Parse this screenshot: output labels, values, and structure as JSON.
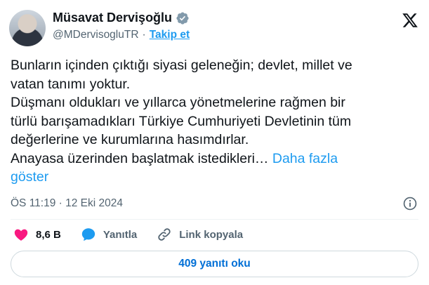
{
  "author": {
    "name": "Müsavat Dervişoğlu",
    "handle": "@MDervisogluTR",
    "separator": "·",
    "follow_label": "Takip et"
  },
  "tweet": {
    "text": "Bunların içinden çıktığı siyasi geleneğin; devlet, millet ve\nvatan tanımı yoktur.\nDüşmanı oldukları ve yıllarca yönetmelerine rağmen bir\ntürlü barışamadıkları Türkiye Cumhuriyeti Devletinin tüm\ndeğerlerine ve kurumlarına hasımdırlar.\nAnayasa üzerinden başlatmak istedikleri… ",
    "show_more_label": "Daha fazla\ngöster",
    "timestamp": "ÖS 11:19 · 12 Eki 2024"
  },
  "actions": {
    "likes_count": "8,6 B",
    "reply_label": "Yanıtla",
    "copy_link_label": "Link kopyala"
  },
  "replies_button_label": "409 yanıtı oku",
  "colors": {
    "accent": "#1d9bf0",
    "like": "#f91880",
    "reply": "#1d9bf0",
    "text": "#0f1419",
    "muted": "#536471"
  },
  "icons": [
    "verified-badge-icon",
    "x-logo-icon",
    "info-icon",
    "heart-icon",
    "reply-bubble-icon",
    "link-icon"
  ]
}
